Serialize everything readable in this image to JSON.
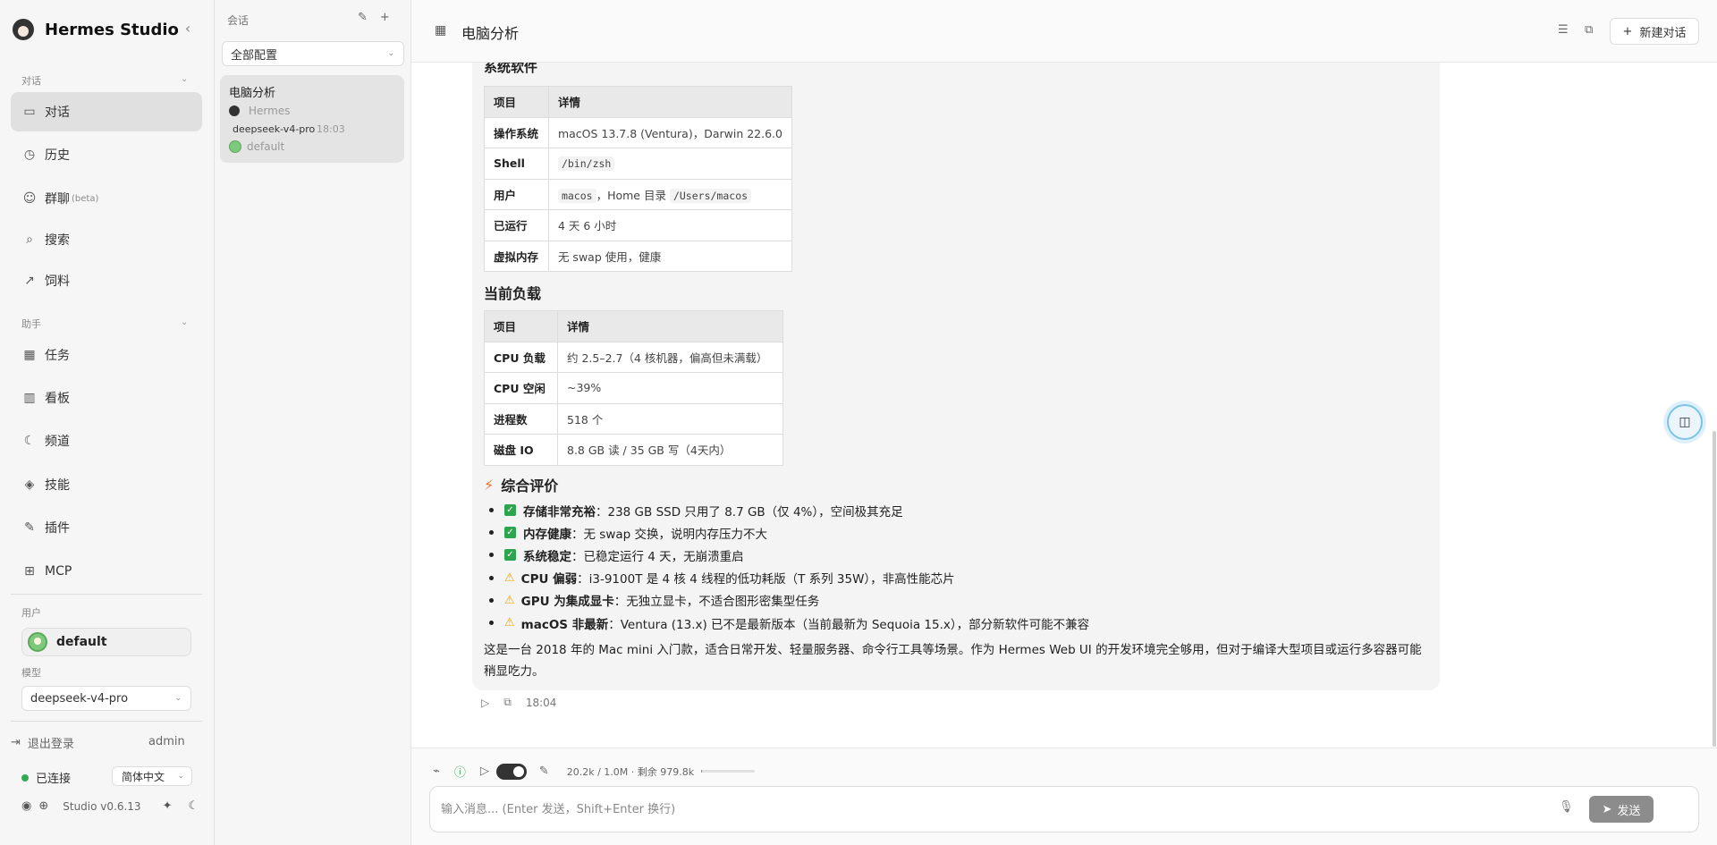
{
  "sidebar": {
    "brand": "Hermes Studio",
    "sections": {
      "chat": "对话",
      "assistant": "助手",
      "user": "用户",
      "model": "模型"
    },
    "items": [
      {
        "label": "对话",
        "icon": "chat-icon"
      },
      {
        "label": "历史",
        "icon": "clock-icon"
      },
      {
        "label": "群聊",
        "badge": "(beta)",
        "icon": "users-icon"
      },
      {
        "label": "搜索",
        "icon": "search-icon"
      },
      {
        "label": "饲料",
        "icon": "external-link-icon"
      },
      {
        "label": "任务",
        "icon": "calendar-icon"
      },
      {
        "label": "看板",
        "icon": "kanban-icon"
      },
      {
        "label": "频道",
        "icon": "moon-icon"
      },
      {
        "label": "技能",
        "icon": "layers-icon"
      },
      {
        "label": "插件",
        "icon": "plug-icon"
      },
      {
        "label": "MCP",
        "icon": "server-icon"
      }
    ],
    "user_name": "default",
    "model_value": "deepseek-v4-pro",
    "logout": "退出登录",
    "admin": "admin",
    "status": "已连接",
    "language": "简体中文",
    "version": "Studio v0.6.13"
  },
  "convlist": {
    "title": "会话",
    "filter": "全部配置",
    "conversation": {
      "title": "电脑分析",
      "agent": "Hermes",
      "model": "deepseek-v4-pro",
      "time": "18:03",
      "profile": "default"
    }
  },
  "main": {
    "title": "电脑分析",
    "new_chat": "新建对话",
    "cut_heading": "系统软件",
    "software_table": {
      "headers": [
        "项目",
        "详情"
      ],
      "rows": [
        {
          "k": "操作系统",
          "v": "macOS 13.7.8 (Ventura)，Darwin 22.6.0"
        },
        {
          "k": "Shell",
          "code": "/bin/zsh"
        },
        {
          "k": "用户",
          "code1": "macos",
          "mid": "，Home 目录",
          "code2": "/Users/macos"
        },
        {
          "k": "已运行",
          "v": "4 天 6 小时"
        },
        {
          "k": "虚拟内存",
          "v": "无 swap 使用，健康"
        }
      ]
    },
    "load_heading": "当前负载",
    "load_table": {
      "headers": [
        "项目",
        "详情"
      ],
      "rows": [
        {
          "k": "CPU 负载",
          "v": "约 2.5–2.7（4 核机器，偏高但未满载）"
        },
        {
          "k": "CPU 空闲",
          "v": "~39%"
        },
        {
          "k": "进程数",
          "v": "518 个"
        },
        {
          "k": "磁盘 IO",
          "v": "8.8 GB 读 / 35 GB 写（4天内）"
        }
      ]
    },
    "eval_heading": "综合评价",
    "eval_items": [
      {
        "mark": "check",
        "b": "存储非常充裕",
        "t": "：238 GB SSD 只用了 8.7 GB（仅 4%），空间极其充足"
      },
      {
        "mark": "check",
        "b": "内存健康",
        "t": "：无 swap 交换，说明内存压力不大"
      },
      {
        "mark": "check",
        "b": "系统稳定",
        "t": "：已稳定运行 4 天，无崩溃重启"
      },
      {
        "mark": "warn",
        "b": "CPU 偏弱",
        "t": "：i3-9100T 是 4 核 4 线程的低功耗版（T 系列 35W），非高性能芯片"
      },
      {
        "mark": "warn",
        "b": "GPU 为集成显卡",
        "t": "：无独立显卡，不适合图形密集型任务"
      },
      {
        "mark": "warn",
        "b": "macOS 非最新",
        "t": "：Ventura (13.x) 已不是最新版本（当前最新为 Sequoia 15.x），部分新软件可能不兼容"
      }
    ],
    "summary": "这是一台 2018 年的 Mac mini 入门款，适合日常开发、轻量服务器、命令行工具等场景。作为 Hermes Web UI 的开发环境完全够用，但对于编译大型项目或运行多容器可能稍显吃力。",
    "msg_time": "18:04"
  },
  "composer": {
    "usage": "20.2k / 1.0M · 剩余 979.8k",
    "usage_fraction": 0.02,
    "placeholder": "输入消息... (Enter 发送，Shift+Enter 换行)",
    "send": "发送"
  },
  "colors": {
    "accent_green": "#2da44e",
    "warn": "#e8a600",
    "bolt": "#f06a28",
    "send_bg": "#8c8c8c"
  }
}
